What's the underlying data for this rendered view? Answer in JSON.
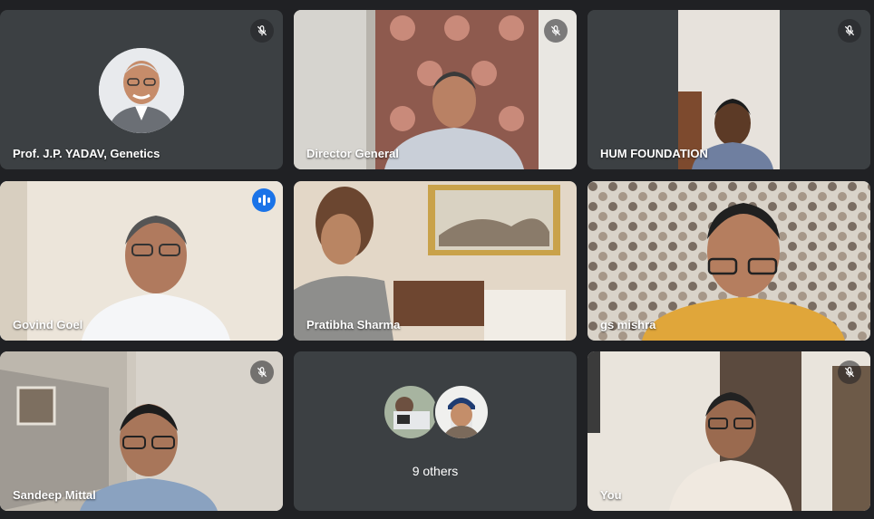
{
  "participants": [
    {
      "name": "Prof. J.P. YADAV, Genetics",
      "muted": true,
      "camera": "off"
    },
    {
      "name": "Director General",
      "muted": true,
      "camera": "on"
    },
    {
      "name": "HUM FOUNDATION",
      "muted": true,
      "camera": "on"
    },
    {
      "name": "Govind Goel",
      "speaking": true,
      "camera": "on"
    },
    {
      "name": "Pratibha Sharma",
      "camera": "on"
    },
    {
      "name": "gs mishra",
      "camera": "on"
    },
    {
      "name": "Sandeep Mittal",
      "muted": true,
      "camera": "on"
    },
    {
      "name": "You",
      "muted": true,
      "camera": "on"
    }
  ],
  "others": {
    "label": "9 others"
  },
  "icons": {
    "muted": "mic-off-icon",
    "speaking": "audio-level-icon"
  },
  "colors": {
    "background": "#202124",
    "tile": "#3c4043",
    "active_speaker_border": "#8ab4f8",
    "speaking_badge": "#1a73e8"
  }
}
